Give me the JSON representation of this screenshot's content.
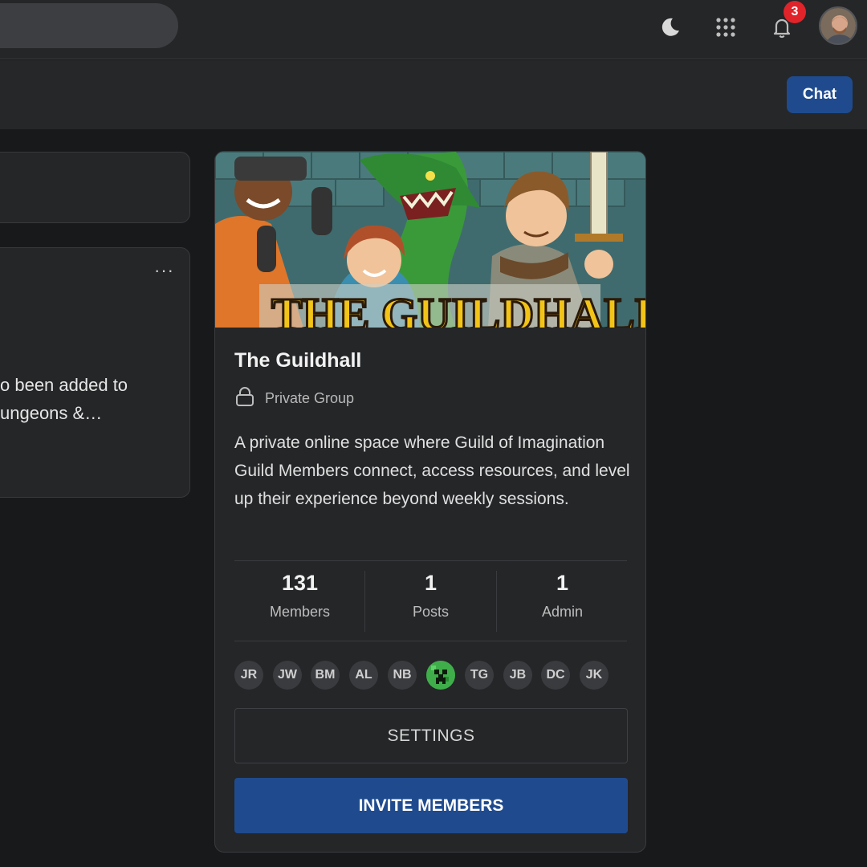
{
  "header": {
    "notification_count": "3",
    "icons": [
      "moon-icon",
      "apps-grid-icon",
      "bell-icon",
      "user-avatar"
    ]
  },
  "subbar": {
    "chat_label": "Chat"
  },
  "feed": {
    "post_text_line1": "o been added to",
    "post_text_line2": "ungeons &…",
    "menu_icon": "more-options-icon"
  },
  "group": {
    "banner_text": "THE GUILDHALL",
    "title": "The Guildhall",
    "privacy": "Private Group",
    "privacy_icon": "lock-icon",
    "description": "A private online space where Guild of Imagination Guild Members connect, access resources, and level up their experience beyond weekly sessions.",
    "stats": [
      {
        "value": "131",
        "label": "Members"
      },
      {
        "value": "1",
        "label": "Posts"
      },
      {
        "value": "1",
        "label": "Admin"
      }
    ],
    "members": [
      "JR",
      "JW",
      "BM",
      "AL",
      "NB",
      "",
      "TG",
      "JB",
      "DC",
      "JK"
    ],
    "settings_label": "SETTINGS",
    "invite_label": "INVITE MEMBERS"
  },
  "colors": {
    "accent": "#1f4b8e",
    "badge": "#e0242a",
    "background": "#18191b",
    "card": "#252628"
  }
}
